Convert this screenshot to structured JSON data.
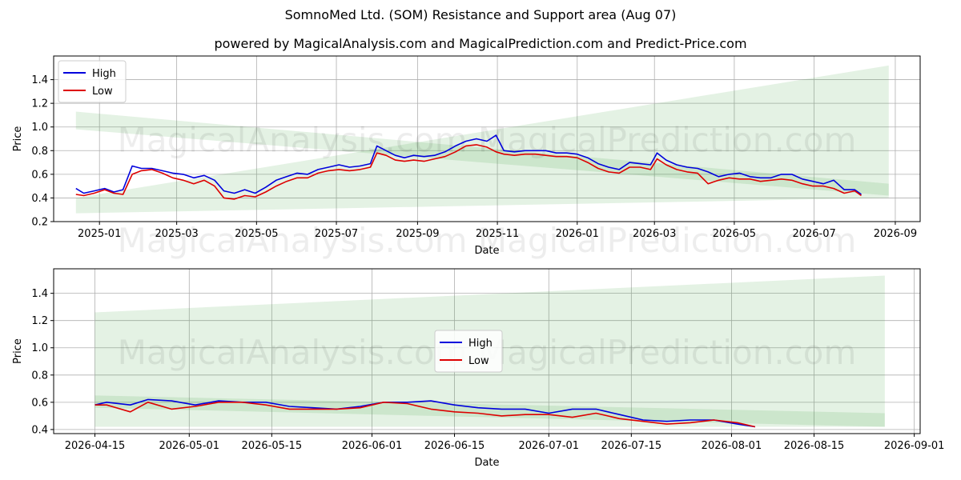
{
  "title": "SomnoMed Ltd. (SOM) Resistance and Support area (Aug 07)",
  "subtitle": "powered by MagicalAnalysis.com and MagicalPrediction.com and Predict-Price.com",
  "watermark": "MagicalAnalysis.com     MagicalPrediction.com",
  "colors": {
    "high": "#0000dd",
    "low": "#dd0000",
    "band": "#2e9a2e",
    "grid": "#b0b0b0"
  },
  "chart_data": [
    {
      "type": "line",
      "xlabel": "Date",
      "ylabel": "Price",
      "xlim": [
        "2024-11-27",
        "2026-09-20"
      ],
      "ylim": [
        0.2,
        1.6
      ],
      "x_ticks": [
        "2025-01",
        "2025-03",
        "2025-05",
        "2025-07",
        "2025-09",
        "2025-11",
        "2026-01",
        "2026-03",
        "2026-05",
        "2026-07",
        "2026-09"
      ],
      "x_tick_dates": [
        "2025-01-01",
        "2025-03-01",
        "2025-05-01",
        "2025-07-01",
        "2025-09-01",
        "2025-11-01",
        "2026-01-01",
        "2026-03-01",
        "2026-05-01",
        "2026-07-01",
        "2026-09-01"
      ],
      "y_ticks": [
        "0.2",
        "0.4",
        "0.6",
        "0.8",
        "1.0",
        "1.2",
        "1.4"
      ],
      "grid": true,
      "legend": "upper left",
      "bands": [
        {
          "x": [
            "2024-12-14",
            "2026-08-27"
          ],
          "upper": [
            1.13,
            0.52
          ],
          "lower": [
            0.98,
            0.42
          ]
        },
        {
          "x": [
            "2024-12-14",
            "2026-08-27"
          ],
          "upper": [
            0.4,
            1.52
          ],
          "lower": [
            0.27,
            0.4
          ]
        }
      ],
      "series": [
        {
          "name": "High",
          "x": [
            "2024-12-14",
            "2024-12-20",
            "2024-12-28",
            "2025-01-05",
            "2025-01-12",
            "2025-01-19",
            "2025-01-26",
            "2025-02-02",
            "2025-02-10",
            "2025-02-18",
            "2025-02-26",
            "2025-03-06",
            "2025-03-14",
            "2025-03-22",
            "2025-03-30",
            "2025-04-06",
            "2025-04-14",
            "2025-04-22",
            "2025-04-30",
            "2025-05-08",
            "2025-05-16",
            "2025-05-24",
            "2025-06-01",
            "2025-06-09",
            "2025-06-17",
            "2025-06-25",
            "2025-07-03",
            "2025-07-11",
            "2025-07-19",
            "2025-07-27",
            "2025-08-01",
            "2025-08-08",
            "2025-08-15",
            "2025-08-22",
            "2025-08-29",
            "2025-09-06",
            "2025-09-14",
            "2025-09-22",
            "2025-09-30",
            "2025-10-08",
            "2025-10-16",
            "2025-10-24",
            "2025-10-31",
            "2025-11-06",
            "2025-11-14",
            "2025-11-22",
            "2025-11-30",
            "2025-12-08",
            "2025-12-16",
            "2025-12-24",
            "2026-01-01",
            "2026-01-09",
            "2026-01-17",
            "2026-01-25",
            "2026-02-02",
            "2026-02-10",
            "2026-02-18",
            "2026-02-26",
            "2026-03-03",
            "2026-03-10",
            "2026-03-18",
            "2026-03-26",
            "2026-04-03",
            "2026-04-11",
            "2026-04-19",
            "2026-04-27",
            "2026-05-05",
            "2026-05-13",
            "2026-05-21",
            "2026-05-29",
            "2026-06-06",
            "2026-06-14",
            "2026-06-22",
            "2026-06-30",
            "2026-07-08",
            "2026-07-16",
            "2026-07-24",
            "2026-08-01",
            "2026-08-06"
          ],
          "values": [
            0.48,
            0.44,
            0.46,
            0.48,
            0.45,
            0.47,
            0.67,
            0.65,
            0.65,
            0.63,
            0.61,
            0.6,
            0.57,
            0.59,
            0.55,
            0.46,
            0.44,
            0.47,
            0.44,
            0.49,
            0.55,
            0.58,
            0.61,
            0.6,
            0.64,
            0.66,
            0.68,
            0.66,
            0.67,
            0.69,
            0.84,
            0.8,
            0.76,
            0.74,
            0.76,
            0.75,
            0.76,
            0.79,
            0.84,
            0.88,
            0.9,
            0.88,
            0.93,
            0.8,
            0.79,
            0.8,
            0.8,
            0.8,
            0.78,
            0.78,
            0.77,
            0.74,
            0.69,
            0.66,
            0.64,
            0.7,
            0.69,
            0.68,
            0.78,
            0.72,
            0.68,
            0.66,
            0.65,
            0.62,
            0.58,
            0.6,
            0.61,
            0.58,
            0.57,
            0.57,
            0.6,
            0.6,
            0.56,
            0.54,
            0.52,
            0.55,
            0.47,
            0.47,
            0.43
          ]
        },
        {
          "name": "Low",
          "x": [
            "2024-12-14",
            "2024-12-20",
            "2024-12-28",
            "2025-01-05",
            "2025-01-12",
            "2025-01-19",
            "2025-01-26",
            "2025-02-02",
            "2025-02-10",
            "2025-02-18",
            "2025-02-26",
            "2025-03-06",
            "2025-03-14",
            "2025-03-22",
            "2025-03-30",
            "2025-04-06",
            "2025-04-14",
            "2025-04-22",
            "2025-04-30",
            "2025-05-08",
            "2025-05-16",
            "2025-05-24",
            "2025-06-01",
            "2025-06-09",
            "2025-06-17",
            "2025-06-25",
            "2025-07-03",
            "2025-07-11",
            "2025-07-19",
            "2025-07-27",
            "2025-08-01",
            "2025-08-08",
            "2025-08-15",
            "2025-08-22",
            "2025-08-29",
            "2025-09-06",
            "2025-09-14",
            "2025-09-22",
            "2025-09-30",
            "2025-10-08",
            "2025-10-16",
            "2025-10-24",
            "2025-10-31",
            "2025-11-06",
            "2025-11-14",
            "2025-11-22",
            "2025-11-30",
            "2025-12-08",
            "2025-12-16",
            "2025-12-24",
            "2026-01-01",
            "2026-01-09",
            "2026-01-17",
            "2026-01-25",
            "2026-02-02",
            "2026-02-10",
            "2026-02-18",
            "2026-02-26",
            "2026-03-03",
            "2026-03-10",
            "2026-03-18",
            "2026-03-26",
            "2026-04-03",
            "2026-04-11",
            "2026-04-19",
            "2026-04-27",
            "2026-05-05",
            "2026-05-13",
            "2026-05-21",
            "2026-05-29",
            "2026-06-06",
            "2026-06-14",
            "2026-06-22",
            "2026-06-30",
            "2026-07-08",
            "2026-07-16",
            "2026-07-24",
            "2026-08-01",
            "2026-08-06"
          ],
          "values": [
            0.43,
            0.42,
            0.44,
            0.47,
            0.44,
            0.43,
            0.6,
            0.63,
            0.64,
            0.61,
            0.57,
            0.55,
            0.52,
            0.55,
            0.5,
            0.4,
            0.39,
            0.42,
            0.41,
            0.45,
            0.5,
            0.54,
            0.57,
            0.57,
            0.61,
            0.63,
            0.64,
            0.63,
            0.64,
            0.66,
            0.78,
            0.76,
            0.72,
            0.71,
            0.72,
            0.71,
            0.73,
            0.75,
            0.79,
            0.84,
            0.85,
            0.83,
            0.79,
            0.77,
            0.76,
            0.77,
            0.77,
            0.76,
            0.75,
            0.75,
            0.74,
            0.7,
            0.65,
            0.62,
            0.61,
            0.66,
            0.66,
            0.64,
            0.73,
            0.68,
            0.64,
            0.62,
            0.61,
            0.52,
            0.55,
            0.57,
            0.56,
            0.56,
            0.54,
            0.55,
            0.56,
            0.55,
            0.52,
            0.5,
            0.5,
            0.48,
            0.44,
            0.46,
            0.42
          ]
        }
      ]
    },
    {
      "type": "line",
      "xlabel": "Date",
      "ylabel": "Price",
      "xlim": [
        "2026-04-08",
        "2026-09-02"
      ],
      "ylim": [
        0.37,
        1.58
      ],
      "x_ticks": [
        "2026-04-15",
        "2026-05-01",
        "2026-05-15",
        "2026-06-01",
        "2026-06-15",
        "2026-07-01",
        "2026-07-15",
        "2026-08-01",
        "2026-08-15",
        "2026-09-01"
      ],
      "y_ticks": [
        "0.4",
        "0.6",
        "0.8",
        "1.0",
        "1.2",
        "1.4"
      ],
      "grid": true,
      "legend": "center",
      "bands": [
        {
          "x": [
            "2026-04-15",
            "2026-08-27"
          ],
          "upper": [
            0.65,
            0.52
          ],
          "lower": [
            0.56,
            0.42
          ]
        },
        {
          "x": [
            "2026-04-15",
            "2026-08-27"
          ],
          "upper": [
            1.26,
            1.53
          ],
          "lower": [
            0.42,
            0.42
          ]
        }
      ],
      "series": [
        {
          "name": "High",
          "x": [
            "2026-04-15",
            "2026-04-17",
            "2026-04-21",
            "2026-04-24",
            "2026-04-28",
            "2026-05-02",
            "2026-05-06",
            "2026-05-10",
            "2026-05-14",
            "2026-05-18",
            "2026-05-22",
            "2026-05-26",
            "2026-05-30",
            "2026-06-03",
            "2026-06-07",
            "2026-06-11",
            "2026-06-15",
            "2026-06-19",
            "2026-06-23",
            "2026-06-27",
            "2026-07-01",
            "2026-07-05",
            "2026-07-09",
            "2026-07-13",
            "2026-07-17",
            "2026-07-21",
            "2026-07-25",
            "2026-07-29",
            "2026-08-02",
            "2026-08-05"
          ],
          "values": [
            0.58,
            0.6,
            0.58,
            0.62,
            0.61,
            0.58,
            0.61,
            0.6,
            0.6,
            0.57,
            0.56,
            0.55,
            0.57,
            0.6,
            0.6,
            0.61,
            0.58,
            0.56,
            0.55,
            0.55,
            0.52,
            0.55,
            0.55,
            0.51,
            0.47,
            0.46,
            0.47,
            0.47,
            0.44,
            0.42
          ]
        },
        {
          "name": "Low",
          "x": [
            "2026-04-15",
            "2026-04-17",
            "2026-04-21",
            "2026-04-24",
            "2026-04-28",
            "2026-05-02",
            "2026-05-06",
            "2026-05-10",
            "2026-05-14",
            "2026-05-18",
            "2026-05-22",
            "2026-05-26",
            "2026-05-30",
            "2026-06-03",
            "2026-06-07",
            "2026-06-11",
            "2026-06-15",
            "2026-06-19",
            "2026-06-23",
            "2026-06-27",
            "2026-07-01",
            "2026-07-05",
            "2026-07-09",
            "2026-07-13",
            "2026-07-17",
            "2026-07-21",
            "2026-07-25",
            "2026-07-29",
            "2026-08-02",
            "2026-08-05"
          ],
          "values": [
            0.58,
            0.58,
            0.53,
            0.6,
            0.55,
            0.57,
            0.6,
            0.6,
            0.58,
            0.55,
            0.55,
            0.55,
            0.56,
            0.6,
            0.59,
            0.55,
            0.53,
            0.52,
            0.5,
            0.51,
            0.51,
            0.49,
            0.52,
            0.48,
            0.46,
            0.44,
            0.45,
            0.47,
            0.45,
            0.42
          ]
        }
      ]
    }
  ]
}
